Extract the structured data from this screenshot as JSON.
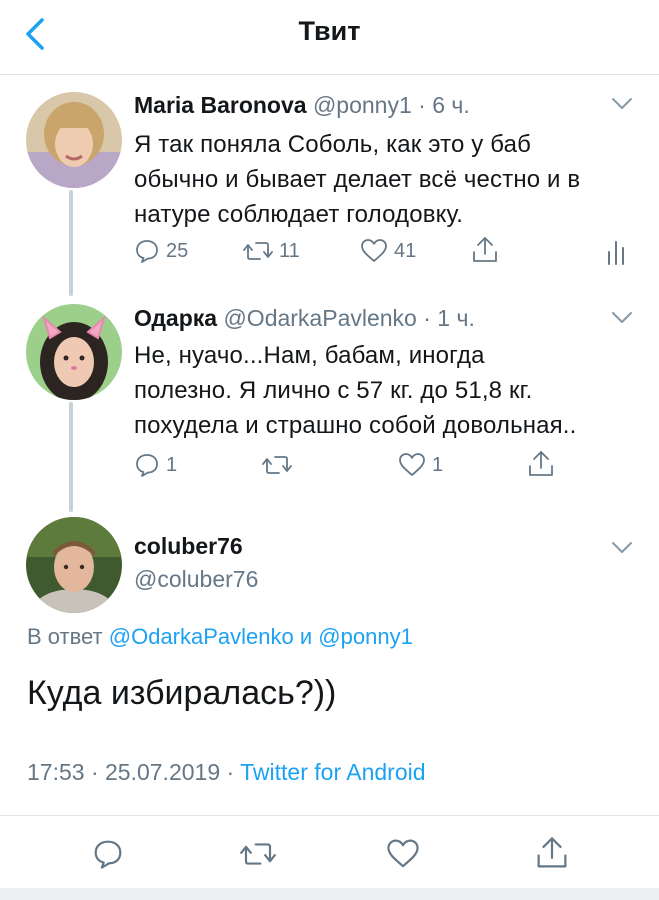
{
  "header": {
    "title": "Твит"
  },
  "tweets": [
    {
      "name": "Maria Baronova",
      "handle": "@ponny1",
      "time": "· 6 ч.",
      "lines": [
        "Я так поняла Соболь, как это у баб",
        "обычно и бывает делает всё честно и в",
        "натуре соблюдает голодовку."
      ],
      "replies": "25",
      "retweets": "11",
      "likes": "41"
    },
    {
      "name": "Одарка",
      "handle": "@OdarkaPavlenko",
      "time": "· 1 ч.",
      "lines": [
        "Не, нуачо...Нам, бабам, иногда",
        "полезно. Я лично с 57 кг. до 51,8 кг.",
        "похудела и страшно собой довольная.."
      ],
      "replies": "1",
      "retweets": "",
      "likes": "1"
    }
  ],
  "main_tweet": {
    "name": "coluber76",
    "handle": "@coluber76",
    "reply_prefix": "В ответ",
    "reply_user1": "@OdarkaPavlenko",
    "reply_and": "и",
    "reply_user2": "@ponny1",
    "text": "Куда избиралась?))",
    "time": "17:53 · 25.07.2019 ·",
    "source": "Twitter for Android"
  },
  "icons": {
    "back": "chevron-left-icon",
    "reply": "speech-bubble-icon",
    "retweet": "retweet-icon",
    "like": "heart-icon",
    "share": "share-icon",
    "analytics": "bar-chart-icon",
    "more": "chevron-down-icon"
  },
  "colors": {
    "accent": "#1da1f2",
    "muted": "#657786",
    "text": "#14171a"
  }
}
